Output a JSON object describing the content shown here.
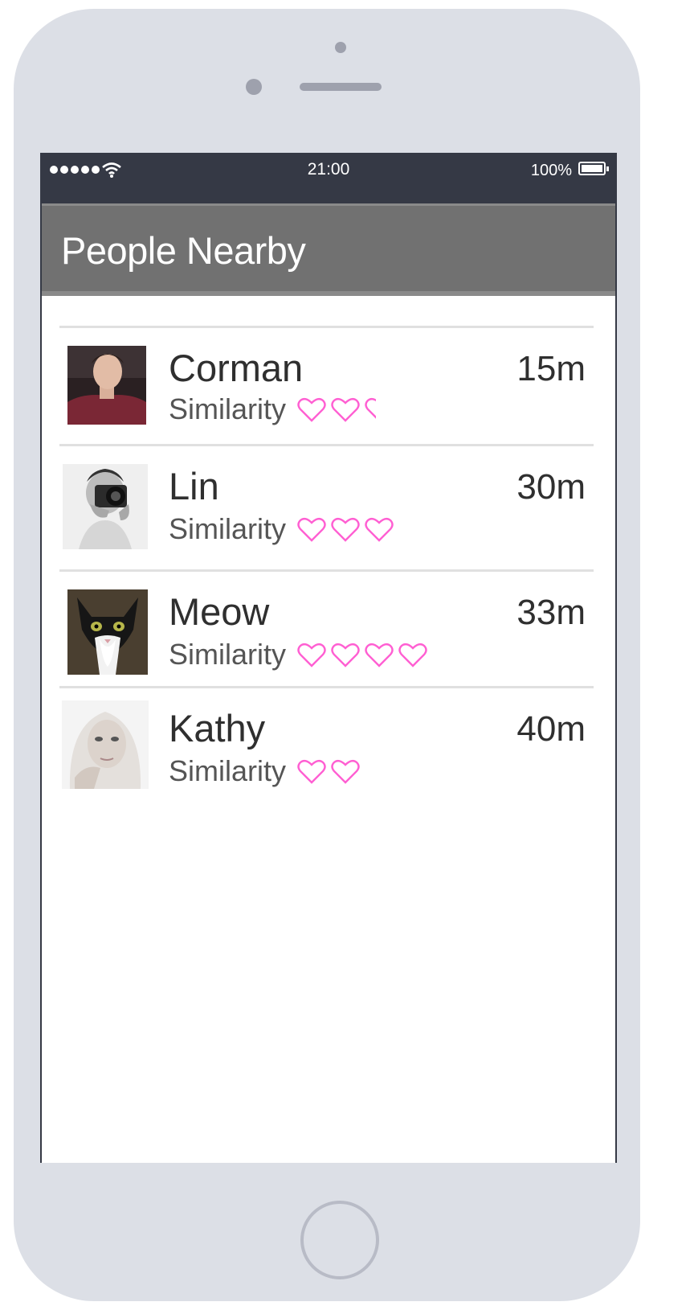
{
  "status_bar": {
    "time": "21:00",
    "battery": "100%",
    "signal_icon": "signal-dots-icon",
    "wifi_icon": "wifi-icon"
  },
  "header": {
    "title": "People Nearby"
  },
  "colors": {
    "status_bar": "#353945",
    "header": "#717171",
    "heart": "#ff5fd2",
    "device": "#dcdfe6"
  },
  "people": [
    {
      "name": "Corman",
      "distance": "15m",
      "similarity_label": "Similarity",
      "hearts": 2.5
    },
    {
      "name": "Lin",
      "distance": "30m",
      "similarity_label": "Similarity",
      "hearts": 3
    },
    {
      "name": "Meow",
      "distance": "33m",
      "similarity_label": "Similarity",
      "hearts": 4
    },
    {
      "name": "Kathy",
      "distance": "40m",
      "similarity_label": "Similarity",
      "hearts": 2
    }
  ]
}
